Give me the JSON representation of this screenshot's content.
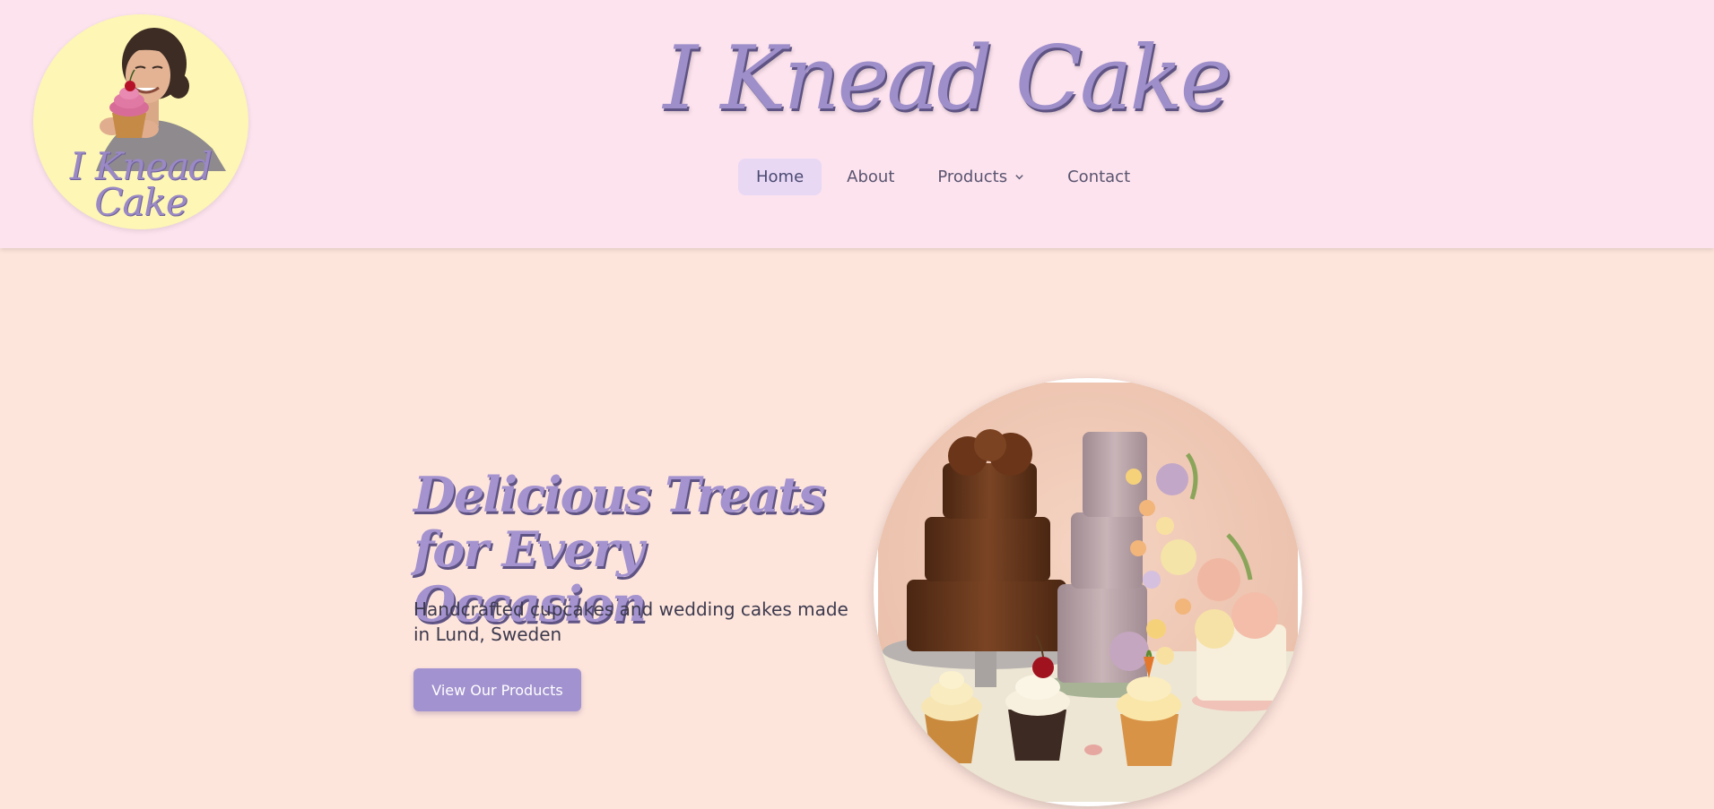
{
  "header": {
    "logo_text_line1": "I Knead",
    "logo_text_line2": "Cake",
    "site_title": "I Knead Cake",
    "nav": [
      {
        "label": "Home",
        "active": true
      },
      {
        "label": "About"
      },
      {
        "label": "Products",
        "has_dropdown": true
      },
      {
        "label": "Contact"
      }
    ]
  },
  "hero": {
    "title": "Delicious Treats for Every Occasion",
    "subtitle": "Handcrafted cupcakes and wedding cakes made in Lund, Sweden",
    "cta_label": "View Our Products"
  },
  "colors": {
    "header_bg": "#fde3ee",
    "page_bg": "#fee5dc",
    "accent_purple": "#a292cf",
    "active_nav_bg": "#e8d8f4",
    "logo_bg": "#fdf6b4"
  },
  "icons": {
    "products_dropdown": "chevron-down-icon"
  }
}
